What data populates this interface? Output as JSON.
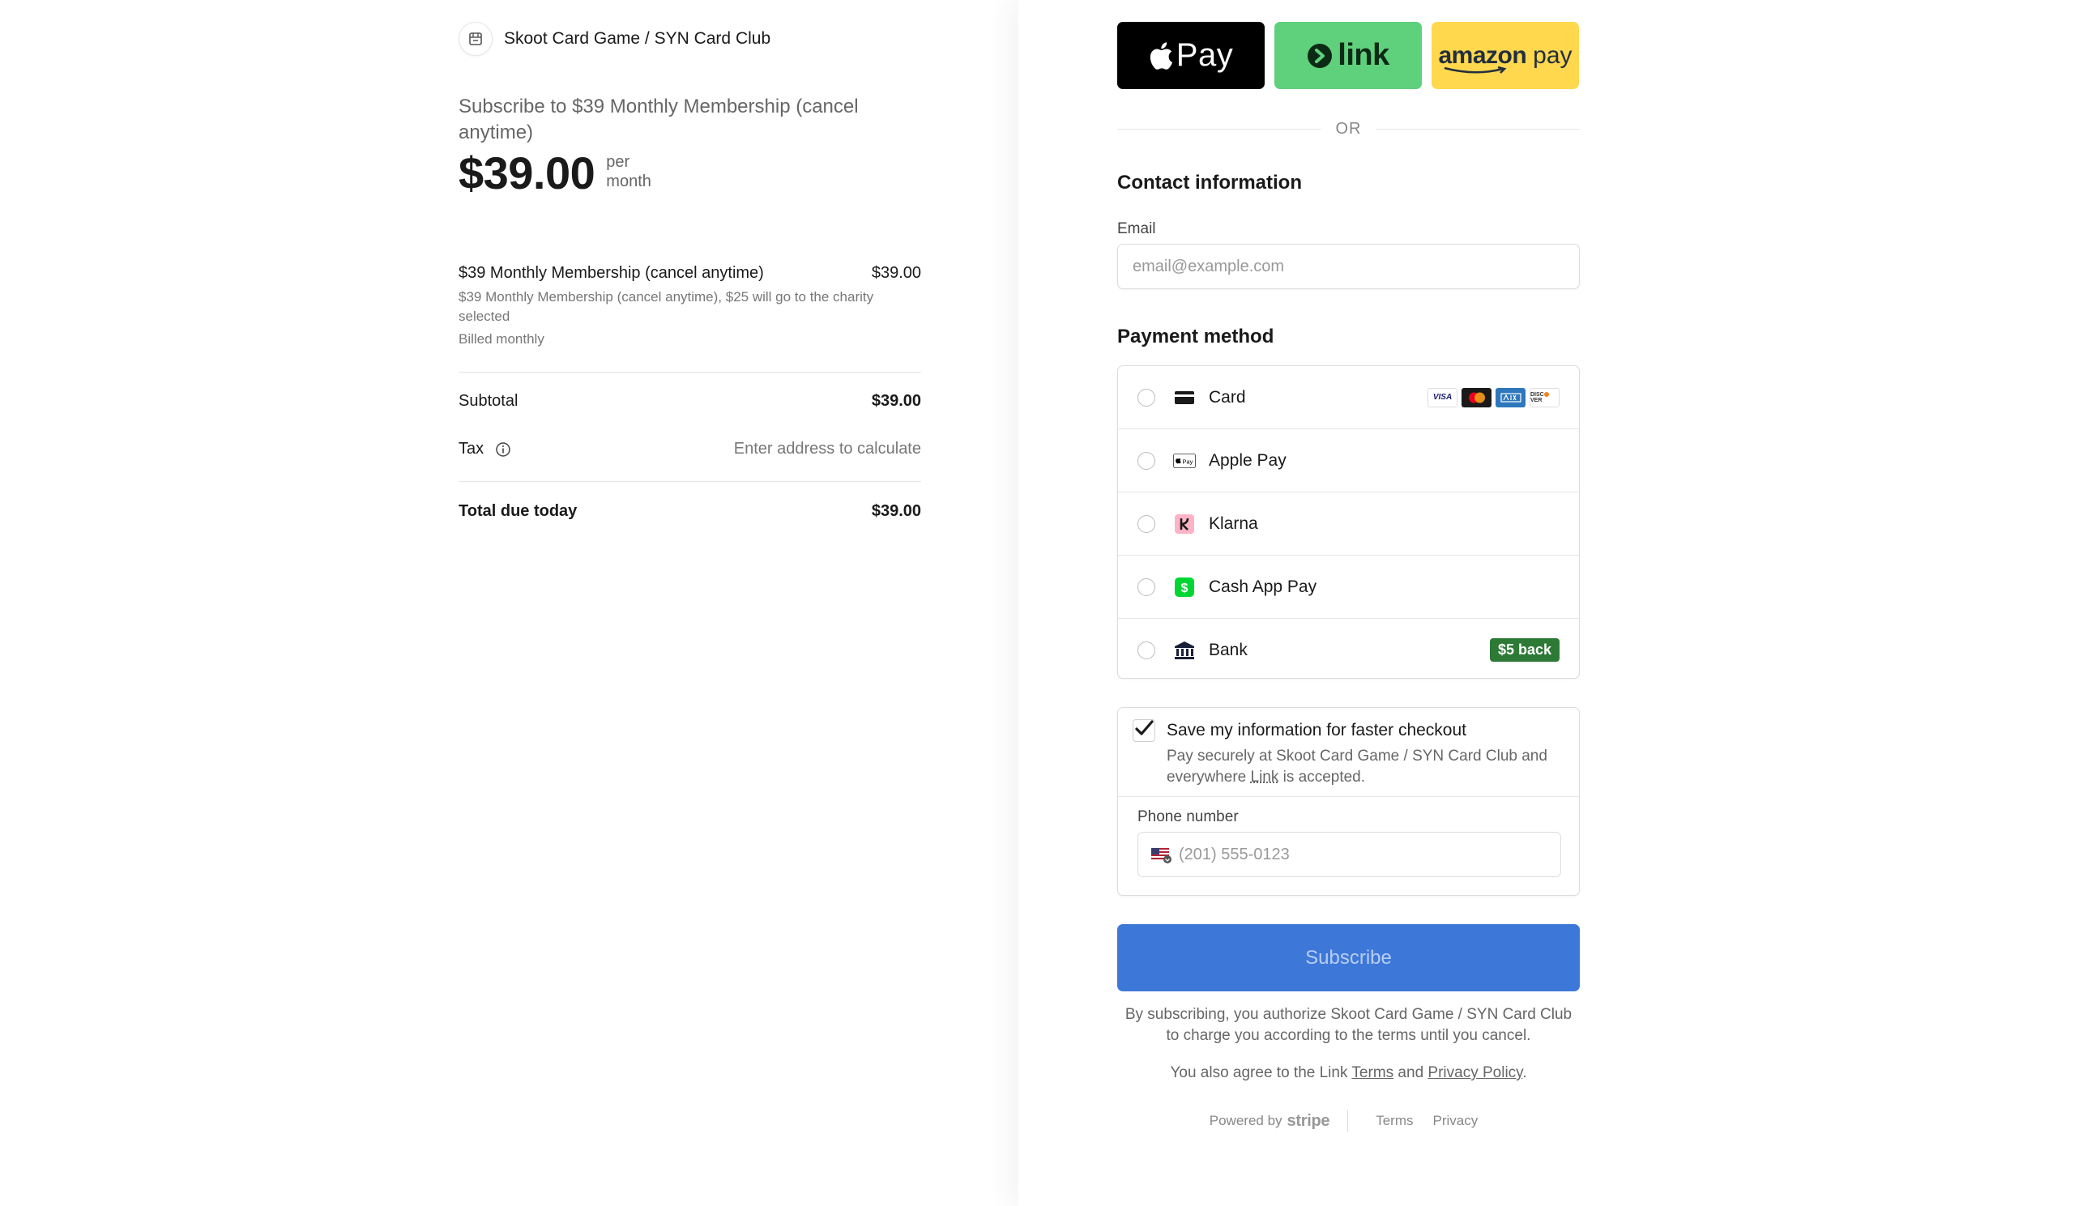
{
  "merchant": {
    "name": "Skoot Card Game / SYN Card Club"
  },
  "summary": {
    "title": "Subscribe to $39 Monthly Membership (cancel anytime)",
    "price": "$39.00",
    "period": "per month"
  },
  "line_item": {
    "name": "$39 Monthly Membership (cancel anytime)",
    "amount": "$39.00",
    "description": "$39 Monthly Membership (cancel anytime), $25 will go to the charity selected",
    "billing": "Billed monthly"
  },
  "totals": {
    "subtotal_label": "Subtotal",
    "subtotal_value": "$39.00",
    "tax_label": "Tax",
    "tax_value": "Enter address to calculate",
    "total_label": "Total due today",
    "total_value": "$39.00"
  },
  "wallets": {
    "apple_pay": "Pay",
    "link": "link",
    "amazon": "amazon",
    "amazon_pay": "pay"
  },
  "divider_text": "OR",
  "contact": {
    "title": "Contact information",
    "email_label": "Email",
    "email_placeholder": "email@example.com"
  },
  "payment": {
    "title": "Payment method",
    "methods": [
      {
        "label": "Card",
        "icon": "card-icon"
      },
      {
        "label": "Apple Pay",
        "icon": "apple-pay-icon"
      },
      {
        "label": "Klarna",
        "icon": "klarna-icon"
      },
      {
        "label": "Cash App Pay",
        "icon": "cash-app-icon"
      },
      {
        "label": "Bank",
        "icon": "bank-icon",
        "badge": "$5 back"
      }
    ],
    "card_brands": [
      "VISA",
      "MC",
      "AMEX",
      "DISCOVER"
    ]
  },
  "save_info": {
    "title": "Save my information for faster checkout",
    "desc_pre": "Pay securely at Skoot Card Game / SYN Card Club and everywhere ",
    "desc_link": "Link",
    "desc_post": " is accepted.",
    "checked": true,
    "phone_label": "Phone number",
    "phone_placeholder": "(201) 555-0123"
  },
  "subscribe_label": "Subscribe",
  "legal": {
    "authorize": "By subscribing, you authorize Skoot Card Game / SYN Card Club to charge you according to the terms until you cancel.",
    "agree_pre": "You also agree to the Link ",
    "terms": "Terms",
    "and": " and ",
    "privacy": "Privacy Policy",
    "period": "."
  },
  "footer": {
    "powered_by": "Powered by",
    "stripe": "stripe",
    "terms": "Terms",
    "privacy": "Privacy"
  },
  "colors": {
    "subscribe_bg": "#3d78d8",
    "link_green": "#5fd07b",
    "amazon_yellow": "#ffd84d",
    "badge_green": "#2d7a36"
  }
}
